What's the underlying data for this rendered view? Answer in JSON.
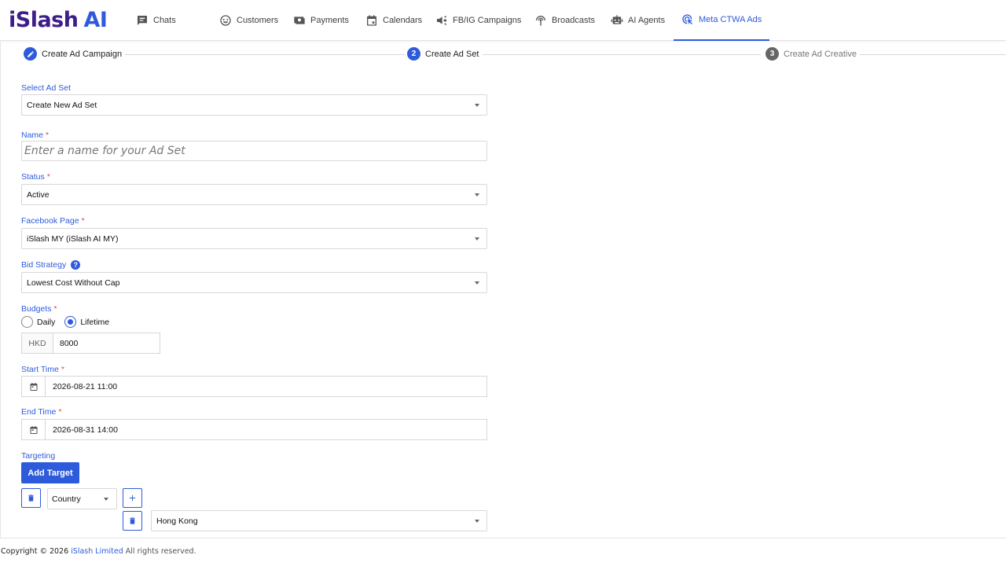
{
  "brand": {
    "name": "iSlash",
    "ai": "AI"
  },
  "nav": [
    {
      "label": "Chats",
      "icon": "chat-icon"
    },
    {
      "label": "Customers",
      "icon": "smile-icon"
    },
    {
      "label": "Payments",
      "icon": "money-icon"
    },
    {
      "label": "Calendars",
      "icon": "calendar-icon"
    },
    {
      "label": "FB/IG Campaigns",
      "icon": "megaphone-icon"
    },
    {
      "label": "Broadcasts",
      "icon": "broadcast-icon"
    },
    {
      "label": "AI Agents",
      "icon": "robot-icon"
    },
    {
      "label": "Meta CTWA Ads",
      "icon": "ads-click-icon",
      "active": true
    }
  ],
  "stepper": {
    "step1": {
      "label": "Create Ad Campaign",
      "state": "done"
    },
    "step2": {
      "number": "2",
      "label": "Create Ad Set",
      "state": "active"
    },
    "step3": {
      "number": "3",
      "label": "Create Ad Creative",
      "state": "pending"
    }
  },
  "form": {
    "select_ad_set": {
      "label": "Select Ad Set",
      "value": "Create New Ad Set"
    },
    "name": {
      "label": "Name",
      "required": "*",
      "placeholder": "Enter a name for your Ad Set"
    },
    "status": {
      "label": "Status",
      "required": "*",
      "value": "Active"
    },
    "facebook_page": {
      "label": "Facebook Page",
      "required": "*",
      "value": "iSlash MY (iSlash AI MY)"
    },
    "bid_strategy": {
      "label": "Bid Strategy",
      "help": "?",
      "value": "Lowest Cost Without Cap"
    },
    "budgets": {
      "label": "Budgets",
      "required": "*",
      "options": [
        "Daily",
        "Lifetime"
      ],
      "selected": "Lifetime",
      "currency": "HKD",
      "amount": "8000"
    },
    "start_time": {
      "label": "Start Time",
      "required": "*",
      "value": "2026-08-21 11:00"
    },
    "end_time": {
      "label": "End Time",
      "required": "*",
      "value": "2026-08-31 14:00"
    },
    "targeting": {
      "label": "Targeting",
      "add_button": "Add Target",
      "type_value": "Country",
      "country_value": "Hong Kong"
    }
  },
  "footer": {
    "copyright": "Copyright © 2026",
    "company": "iSlash Limited",
    "rights": "All rights reserved."
  },
  "colors": {
    "accent": "#2e5bdb",
    "brand": "#3d1d8a",
    "required": "#e0493e"
  }
}
